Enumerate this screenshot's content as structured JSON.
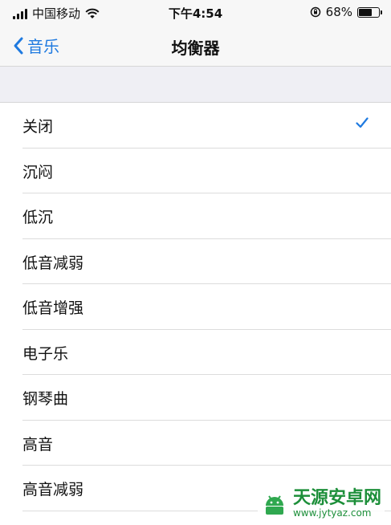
{
  "status_bar": {
    "carrier": "中国移动",
    "time": "下午4:54",
    "battery_percent": "68%",
    "battery_level": 0.68
  },
  "nav": {
    "back_label": "音乐",
    "title": "均衡器"
  },
  "equalizer": {
    "items": [
      {
        "label": "关闭",
        "selected": true
      },
      {
        "label": "沉闷",
        "selected": false
      },
      {
        "label": "低沉",
        "selected": false
      },
      {
        "label": "低音减弱",
        "selected": false
      },
      {
        "label": "低音增强",
        "selected": false
      },
      {
        "label": "电子乐",
        "selected": false
      },
      {
        "label": "钢琴曲",
        "selected": false
      },
      {
        "label": "高音",
        "selected": false
      },
      {
        "label": "高音减弱",
        "selected": false
      }
    ]
  },
  "watermark": {
    "name": "天源安卓网",
    "url": "www.jytyaz.com"
  },
  "colors": {
    "accent": "#1f7ae0",
    "separator": "#dcdcdc",
    "group_background": "#efeff4"
  }
}
